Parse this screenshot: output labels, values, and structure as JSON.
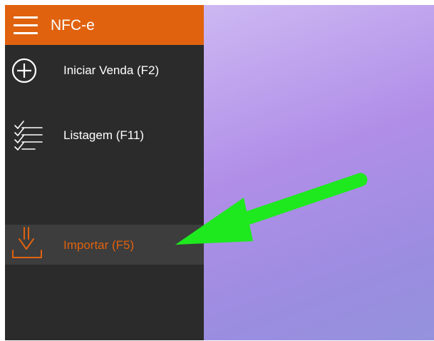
{
  "header": {
    "title": "NFC-e",
    "menu_icon": "hamburger-menu-icon"
  },
  "menu": {
    "items": [
      {
        "label": "Iniciar Venda (F2)",
        "icon": "plus-circle-icon",
        "active": false
      },
      {
        "label": "Listagem (F11)",
        "icon": "checklist-icon",
        "active": false
      },
      {
        "label": "Importar (F5)",
        "icon": "import-download-icon",
        "active": true
      }
    ]
  },
  "colors": {
    "accent": "#e0620e",
    "sidebar_bg": "#2b2b2b",
    "selected_item_bg": "#3d3d3d",
    "annotation_arrow": "#1ee81e"
  },
  "annotation": {
    "type": "arrow",
    "points_to": "Importar (F5)"
  }
}
